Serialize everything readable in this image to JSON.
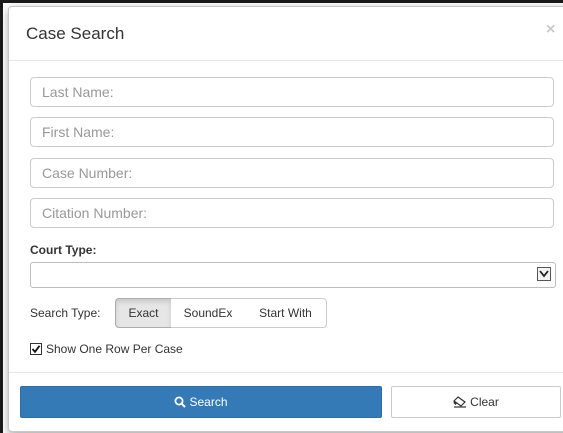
{
  "dialog": {
    "title": "Case Search",
    "close_glyph": "×"
  },
  "fields": {
    "last_name": {
      "value": "",
      "placeholder": "Last Name:"
    },
    "first_name": {
      "value": "",
      "placeholder": "First Name:"
    },
    "case_number": {
      "value": "",
      "placeholder": "Case Number:"
    },
    "citation_number": {
      "value": "",
      "placeholder": "Citation Number:"
    }
  },
  "court_type": {
    "label": "Court Type:",
    "selected": ""
  },
  "search_type": {
    "label": "Search Type:",
    "options": [
      "Exact",
      "SoundEx",
      "Start With"
    ],
    "selected": "Exact"
  },
  "options": {
    "one_row_per_case": {
      "label": "Show One Row Per Case",
      "checked": true
    }
  },
  "actions": {
    "search_label": "Search",
    "search_icon": "search-icon",
    "clear_label": "Clear",
    "clear_icon": "eraser-icon"
  },
  "colors": {
    "primary": "#337ab7",
    "active_segment": "#e6e6e6"
  }
}
